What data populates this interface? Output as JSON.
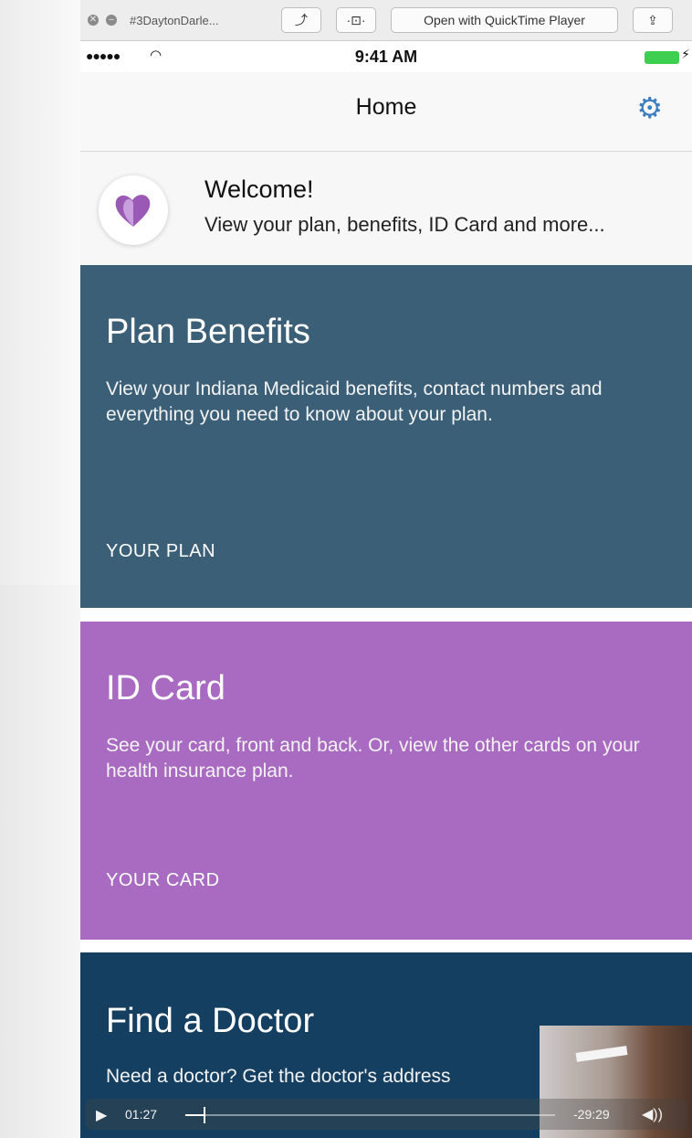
{
  "quicktime": {
    "window_title": "#3DaytonDarle...",
    "open_button": "Open with QuickTime Player"
  },
  "status_bar": {
    "time": "9:41 AM"
  },
  "nav": {
    "title": "Home"
  },
  "welcome": {
    "title": "Welcome!",
    "subtitle": "View your plan, benefits, ID Card and more..."
  },
  "cards": [
    {
      "title": "Plan Benefits",
      "description": "View your Indiana Medicaid benefits, contact numbers and everything you need to know about your plan.",
      "link": "YOUR PLAN",
      "color": "#3b5f77"
    },
    {
      "title": "ID Card",
      "description": "See your card, front and back. Or, view the other cards on your health insurance plan.",
      "link": "YOUR CARD",
      "color": "#a96bc1"
    },
    {
      "title": "Find a Doctor",
      "description": "Need a doctor? Get the doctor's address",
      "color": "#153f60"
    }
  ],
  "player": {
    "elapsed": "01:27",
    "remaining": "-29:29",
    "progress": 0.05
  },
  "accent_color": "#3a7fc1"
}
